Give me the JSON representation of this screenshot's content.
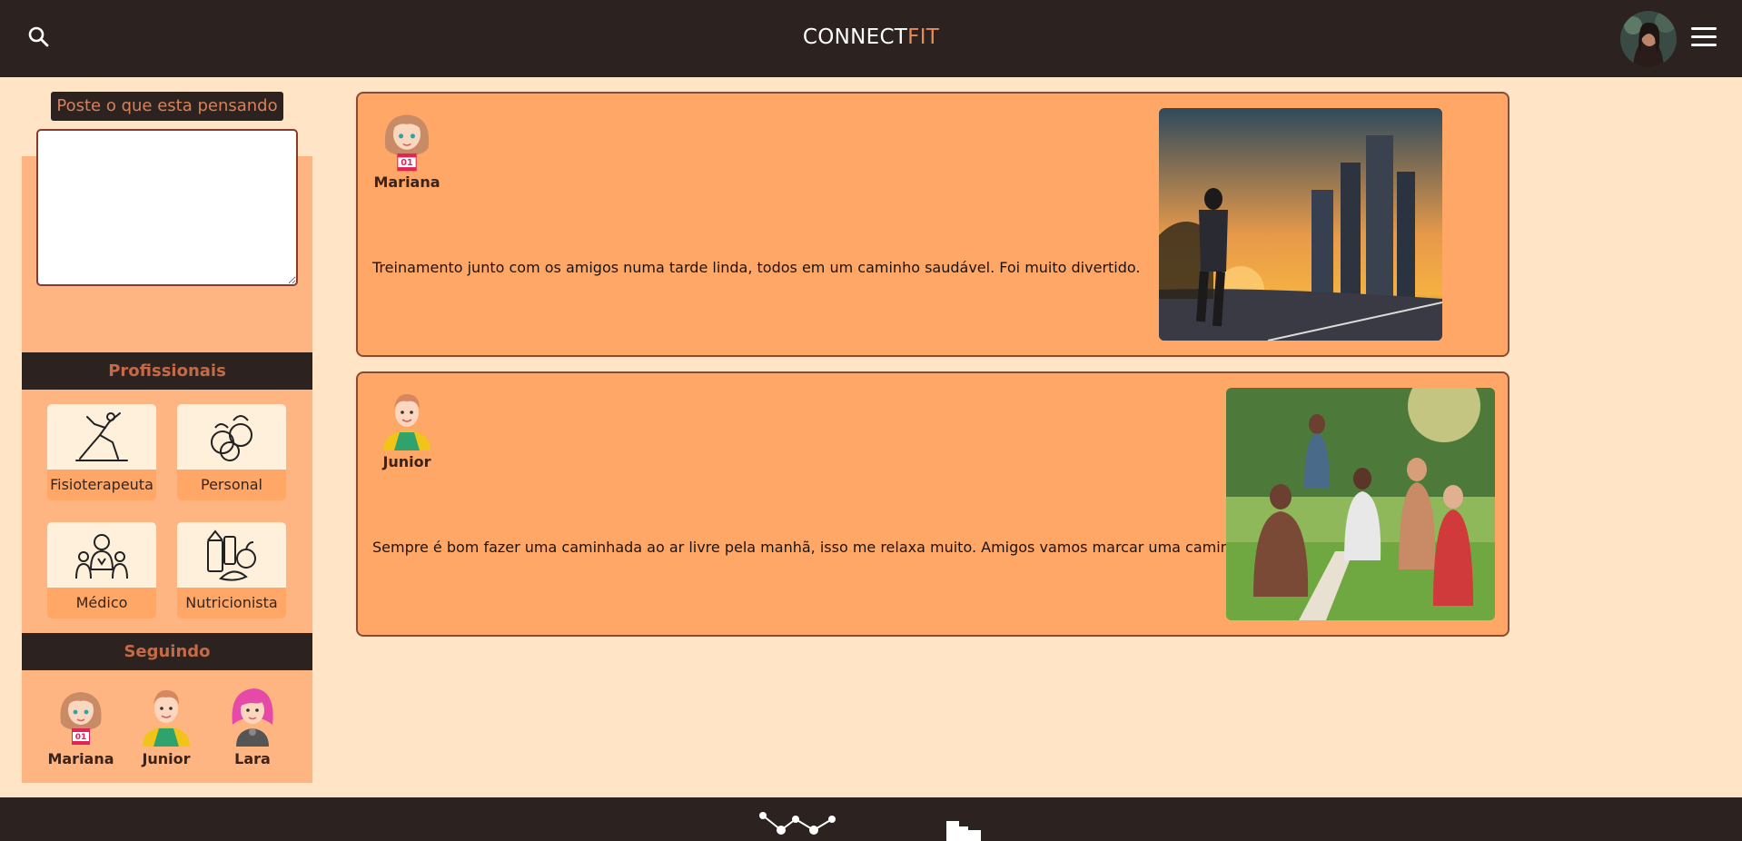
{
  "header": {
    "brand_part1": "CONNECT",
    "brand_part2": "FIT"
  },
  "composer": {
    "label": "Poste o que esta pensando",
    "text_value": ""
  },
  "professionals": {
    "title": "Profissionais",
    "items": [
      {
        "label": "Fisioterapeuta",
        "icon": "stretching-person-icon"
      },
      {
        "label": "Personal",
        "icon": "kettlebells-icon"
      },
      {
        "label": "Médico",
        "icon": "doctor-group-icon"
      },
      {
        "label": "Nutricionista",
        "icon": "food-basket-icon"
      }
    ]
  },
  "following": {
    "title": "Seguindo",
    "users": [
      {
        "name": "Mariana"
      },
      {
        "name": "Junior"
      },
      {
        "name": "Lara"
      }
    ]
  },
  "posts": [
    {
      "author": "Mariana",
      "text": "Treinamento junto com os amigos numa tarde linda, todos em um caminho saudável. Foi muito divertido.",
      "image": "runner-city-sunset-photo"
    },
    {
      "author": "Junior",
      "text": "Sempre é bom fazer uma caminhada ao ar livre pela manhã, isso me relaxa muito. Amigos vamos marcar uma caminhada?",
      "image": "outdoor-yoga-group-photo"
    }
  ],
  "colors": {
    "header_bg": "#2c2320",
    "page_bg": "#ffe4c6",
    "sidebar_bg": "#ffb581",
    "card_bg": "#ffa766",
    "accent": "#e98a57"
  }
}
